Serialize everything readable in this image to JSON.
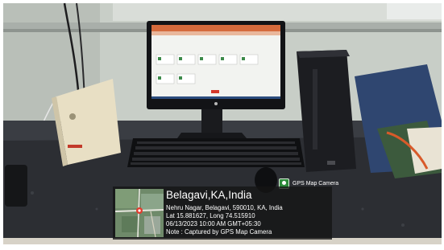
{
  "photo": {
    "description_icons": [
      "computer-monitor",
      "keyboard",
      "mouse",
      "cpu-tower",
      "ups-battery",
      "bag"
    ],
    "colors": {
      "wall": "#c7cdc6",
      "counter": "#2c2e33",
      "monitor_screen": "#f2f3f0",
      "ups_body": "#e8dfc4",
      "bag": "#2f4670"
    }
  },
  "overlay": {
    "badge_label": "GPS Map Camera",
    "title": "Belagavi,KA,India",
    "address": "Nehru Nagar, Belagavi, 590010, KA, India",
    "coordinates": "Lat 15.881627, Long 74.515910",
    "timestamp": "06/13/2023 10:00 AM GMT+05:30",
    "note": "Note : Captured by GPS Map Camera"
  }
}
